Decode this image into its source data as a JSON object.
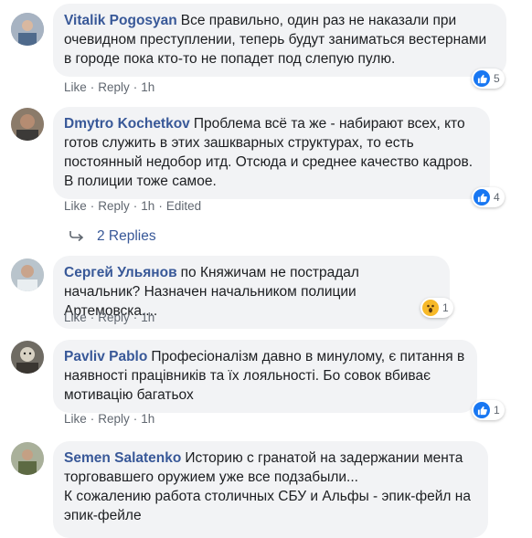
{
  "comments": [
    {
      "author": "Vitalik Pogosyan",
      "text": "Все правильно, один раз не наказали при очевидном преступлении, теперь будут заниматься вестернами в городе пока кто-то не попадет под слепую пулю.",
      "like": "Like",
      "reply": "Reply",
      "time": "1h",
      "reaction_count": "5",
      "reaction_icon": "like-icon"
    },
    {
      "author": "Dmytro Kochetkov",
      "text": "Проблема всё та же - набирают всех, кто готов служить в этих зашкварных структурах, то есть постоянный недобор итд. Отсюда и среднее качество кадров. В полиции тоже самое.",
      "like": "Like",
      "reply": "Reply",
      "time": "1h",
      "edited": "Edited",
      "reaction_count": "4",
      "reaction_icon": "like-icon",
      "replies_label": "2 Replies"
    },
    {
      "author": "Сергей Ульянов",
      "text": "по Княжичам не пострадал начальник? Назначен начальником полиции Артемовска....",
      "like": "Like",
      "reply": "Reply",
      "time": "1h",
      "reaction_count": "1",
      "reaction_icon": "wow-icon"
    },
    {
      "author": "Pavliv Pablo",
      "text": "Професіоналізм давно в минулому, є питання в наявності працівників та їх лояльності. Бо совок вбиває мотивацію багатьох",
      "like": "Like",
      "reply": "Reply",
      "time": "1h",
      "reaction_count": "1",
      "reaction_icon": "like-icon"
    },
    {
      "author": "Semen Salatenko",
      "text": "Историю с гранатой на задержании мента торговавшего оружием уже все подзабыли...",
      "text2": "К сожалению работа столичных СБУ и Альфы - эпик-фейл на эпик-фейле"
    }
  ],
  "colors": {
    "author": "#385898",
    "bubble": "#f2f3f5",
    "meta": "#606770",
    "like_blue": "#1877f2",
    "wow_yellow": "#f7b928"
  }
}
